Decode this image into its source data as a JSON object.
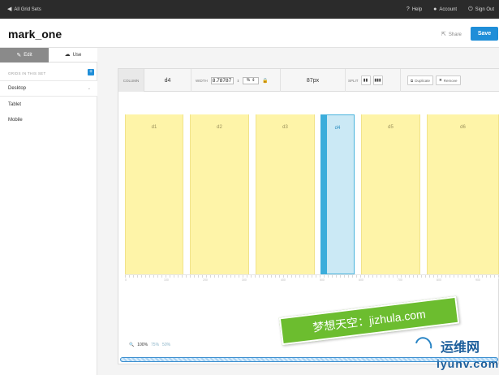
{
  "topbar": {
    "back_label": "All Grid Sets",
    "help_label": "Help",
    "account_label": "Account",
    "signout_label": "Sign Out"
  },
  "header": {
    "title": "mark_one",
    "share_label": "Share",
    "save_label": "Save"
  },
  "sidebar": {
    "tabs": [
      {
        "label": "Edit",
        "icon": "edit-icon",
        "active": true
      },
      {
        "label": "Use",
        "icon": "download-icon",
        "active": false
      }
    ],
    "grids_label": "GRIDS IN THIS SET",
    "add_label": "+",
    "items": [
      {
        "label": "Desktop",
        "active": true
      },
      {
        "label": "Tablet",
        "active": false
      },
      {
        "label": "Mobile",
        "active": false
      }
    ]
  },
  "toolbar": {
    "column_label": "COLUMN",
    "column_name": "d4",
    "width_label": "WIDTH",
    "width_value": "8.78787",
    "unit": "%",
    "px_value": "87px",
    "split_label": "SPLIT",
    "duplicate_label": "Duplicate",
    "remove_label": "Remove"
  },
  "grid": {
    "columns": [
      {
        "label": "d1",
        "selected": false
      },
      {
        "label": "d2",
        "selected": false
      },
      {
        "label": "d3",
        "selected": false
      },
      {
        "label": "d4",
        "selected": true
      },
      {
        "label": "d5",
        "selected": false
      },
      {
        "label": "d6",
        "selected": false
      }
    ],
    "colors": {
      "column": "#fef4a8",
      "selected": "#cbe9f5",
      "accent": "#1f8ed8"
    },
    "ruler_labels": [
      "0",
      "100",
      "200",
      "300",
      "400",
      "500",
      "600",
      "700",
      "800",
      "900"
    ]
  },
  "zoom": {
    "current": "100%",
    "options": [
      "75%",
      "50%"
    ]
  },
  "watermark": {
    "ribbon_text": "梦想天空：jizhula.com",
    "logo_zh": "运维网",
    "logo_en": "iyunv.com"
  }
}
